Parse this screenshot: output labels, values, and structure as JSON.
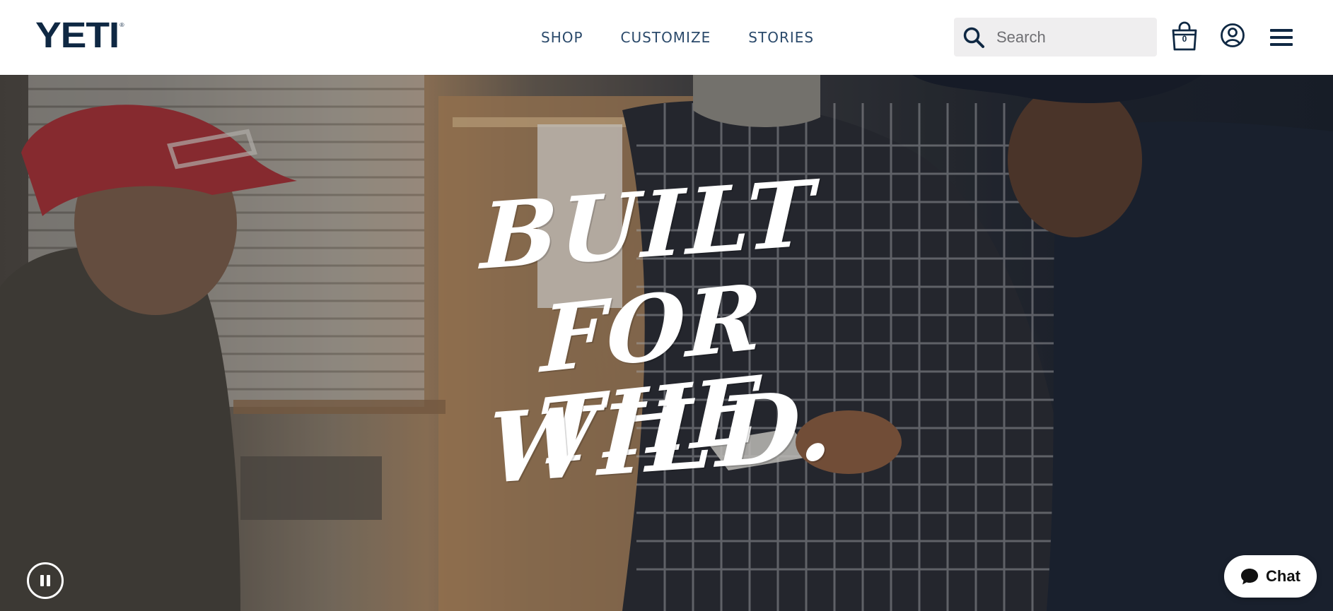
{
  "header": {
    "logo_text": "YETI",
    "logo_mark": "®",
    "nav": [
      {
        "label": "SHOP"
      },
      {
        "label": "CUSTOMIZE"
      },
      {
        "label": "STORIES"
      }
    ],
    "search": {
      "placeholder": "Search"
    },
    "cart_count": "0",
    "icons": {
      "search": "search-icon",
      "cart": "shopping-bag-icon",
      "account": "account-icon",
      "menu": "hamburger-menu-icon"
    }
  },
  "hero": {
    "headline": {
      "line1": "BUILT",
      "line2": "FOR THE",
      "line3": "WILD."
    },
    "pause_icon": "pause-icon"
  },
  "chat": {
    "label": "Chat",
    "icon": "chat-bubble-icon"
  },
  "colors": {
    "brand_navy": "#0f2843",
    "nav_text": "#2b4a6b",
    "search_bg": "#efeeef",
    "hero_text": "#ffffff"
  }
}
